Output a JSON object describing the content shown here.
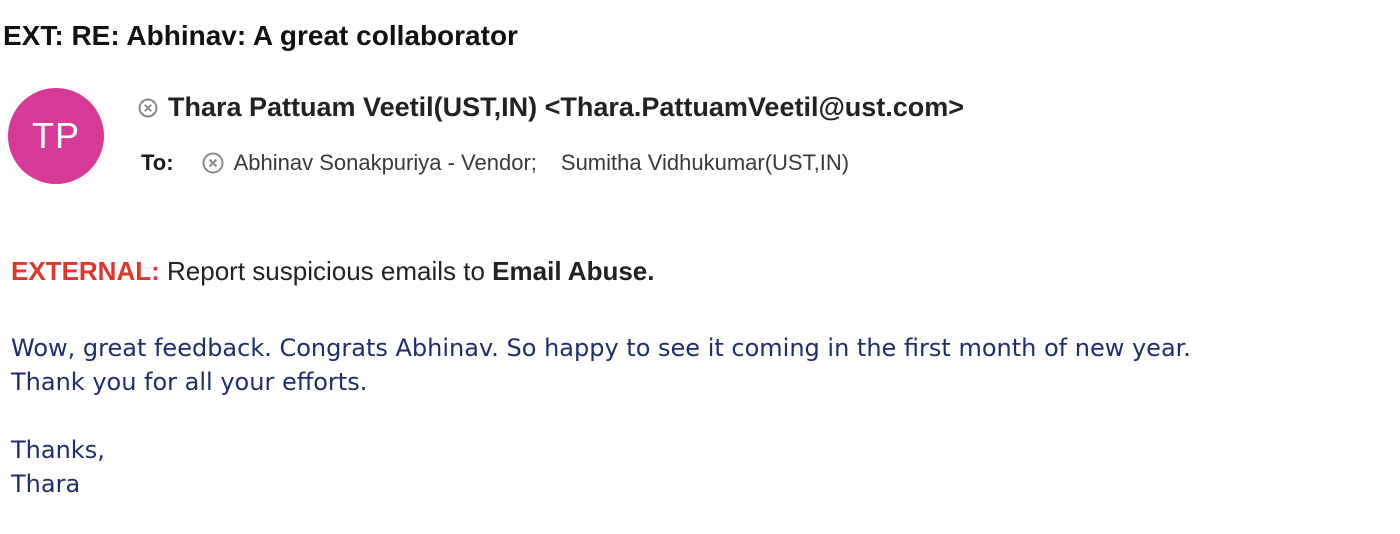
{
  "email": {
    "subject": "EXT: RE: Abhinav: A great collaborator",
    "avatar_initials": "TP",
    "avatar_color": "#d63a96",
    "sender": "Thara Pattuam Veetil(UST,IN) <Thara.PattuamVeetil@ust.com>",
    "to_label": "To:",
    "recipients": [
      "Abhinav Sonakpuriya - Vendor;",
      "Sumitha Vidhukumar(UST,IN)"
    ],
    "icons": {
      "sender_status": "circle-x-icon",
      "recipient_status": "circle-x-icon"
    }
  },
  "banner": {
    "tag": "EXTERNAL:",
    "tag_color": "#e0352b",
    "text": "Report suspicious emails to",
    "link": "Email Abuse."
  },
  "body": {
    "text_color": "#1f2d6b",
    "lines": [
      "Wow, great feedback. Congrats Abhinav. So happy to see it coming in the first month of new year.",
      "Thank you for all your efforts.",
      "",
      "Thanks,",
      "Thara"
    ]
  }
}
